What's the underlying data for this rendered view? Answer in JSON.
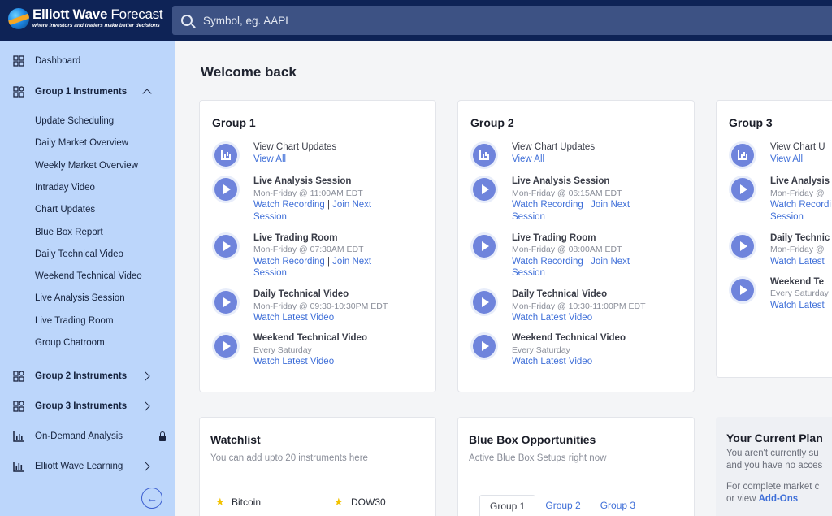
{
  "header": {
    "logo_title_bold": "Elliott Wave",
    "logo_title_rest": " Forecast",
    "logo_tagline": "where investors and traders make better decisions",
    "search_placeholder": "Symbol, eg. AAPL"
  },
  "sidebar": {
    "dashboard": "Dashboard",
    "group1": "Group 1 Instruments",
    "group1_items": [
      "Update Scheduling",
      "Daily Market Overview",
      "Weekly Market Overview",
      "Intraday Video",
      "Chart Updates",
      "Blue Box Report",
      "Daily Technical Video",
      "Weekend Technical Video",
      "Live Analysis Session",
      "Live Trading Room",
      "Group Chatroom"
    ],
    "group2": "Group 2 Instruments",
    "group3": "Group 3 Instruments",
    "on_demand": "On-Demand Analysis",
    "learning": "Elliott Wave Learning",
    "collapse_icon": "arrow-left-icon"
  },
  "main": {
    "welcome": "Welcome back",
    "groups": [
      {
        "title": "Group 1",
        "chart_updates": "View Chart Updates",
        "view_all": "View All",
        "live_analysis": {
          "title": "Live Analysis Session",
          "schedule": "Mon-Friday @ 11:00AM EDT",
          "watch": "Watch Recording",
          "join": "Join Next",
          "join2": "Session"
        },
        "trading_room": {
          "title": "Live Trading Room",
          "schedule": "Mon-Friday @ 07:30AM EDT",
          "watch": "Watch Recording",
          "join": "Join Next",
          "join2": "Session"
        },
        "daily_video": {
          "title": "Daily Technical Video",
          "schedule": "Mon-Friday @ 09:30-10:30PM EDT",
          "watch": "Watch Latest Video"
        },
        "weekend_video": {
          "title": "Weekend Technical Video",
          "schedule": "Every Saturday",
          "watch": "Watch Latest Video"
        }
      },
      {
        "title": "Group 2",
        "chart_updates": "View Chart Updates",
        "view_all": "View All",
        "live_analysis": {
          "title": "Live Analysis Session",
          "schedule": "Mon-Friday @ 06:15AM EDT",
          "watch": "Watch Recording",
          "join": "Join Next",
          "join2": "Session"
        },
        "trading_room": {
          "title": "Live Trading Room",
          "schedule": "Mon-Friday @ 08:00AM EDT",
          "watch": "Watch Recording",
          "join": "Join Next",
          "join2": "Session"
        },
        "daily_video": {
          "title": "Daily Technical Video",
          "schedule": "Mon-Friday @ 10:30-11:00PM EDT",
          "watch": "Watch Latest Video"
        },
        "weekend_video": {
          "title": "Weekend Technical Video",
          "schedule": "Every Saturday",
          "watch": "Watch Latest Video"
        }
      },
      {
        "title": "Group 3",
        "chart_updates": "View Chart U",
        "view_all": "View All",
        "live_analysis": {
          "title": "Live Analysis",
          "schedule": "Mon-Friday @",
          "watch": "Watch Recordi",
          "join2": "Session"
        },
        "daily_video": {
          "title": "Daily Technic",
          "schedule": "Mon-Friday @",
          "watch": "Watch Latest"
        },
        "weekend_video": {
          "title": "Weekend Te",
          "schedule": "Every Saturday",
          "watch": "Watch Latest"
        }
      }
    ],
    "watchlist": {
      "title": "Watchlist",
      "subtitle": "You can add upto 20 instruments here",
      "items": [
        "Bitcoin",
        "DOW30"
      ]
    },
    "bluebox": {
      "title": "Blue Box Opportunities",
      "subtitle": "Active Blue Box Setups right now",
      "tabs": [
        "Group 1",
        "Group 2",
        "Group 3"
      ]
    },
    "plan": {
      "title": "Your Current Plan",
      "line1": "You aren't currently su",
      "line2": "and you have no acces",
      "line3": "For complete market c",
      "line4_prefix": "or view ",
      "line4_link": "Add-Ons"
    }
  },
  "colors": {
    "header_bg": "#0e2356",
    "sidebar_bg": "#bcd6fb",
    "accent": "#6f84dc",
    "link": "#3f6fd8"
  }
}
